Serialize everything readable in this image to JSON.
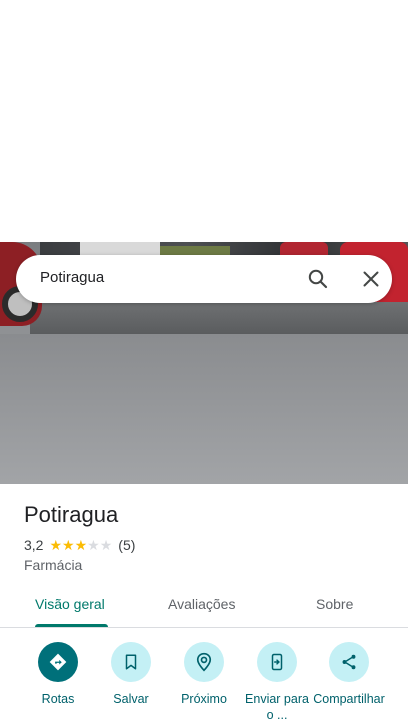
{
  "search": {
    "query": "Potiragua"
  },
  "place": {
    "name": "Potiragua",
    "rating": "3,2",
    "rating_stars_filled": 3,
    "rating_stars_total": 5,
    "review_count": "(5)",
    "category": "Farmácia"
  },
  "tabs": [
    {
      "label": "Visão geral",
      "active": true
    },
    {
      "label": "Avaliações",
      "active": false
    },
    {
      "label": "Sobre",
      "active": false
    }
  ],
  "actions": [
    {
      "label": "Rotas",
      "icon": "directions-icon"
    },
    {
      "label": "Salvar",
      "icon": "bookmark-icon"
    },
    {
      "label": "Próximo",
      "icon": "nearby-icon"
    },
    {
      "label": "Enviar para o ...",
      "icon": "send-to-phone-icon"
    },
    {
      "label": "Compartilhar",
      "icon": "share-icon"
    }
  ],
  "colors": {
    "accent": "#00796b",
    "star": "#fbbc04",
    "star_empty": "#dadce0",
    "action_bg": "#c4f0f5",
    "action_primary_bg": "#00707a"
  }
}
